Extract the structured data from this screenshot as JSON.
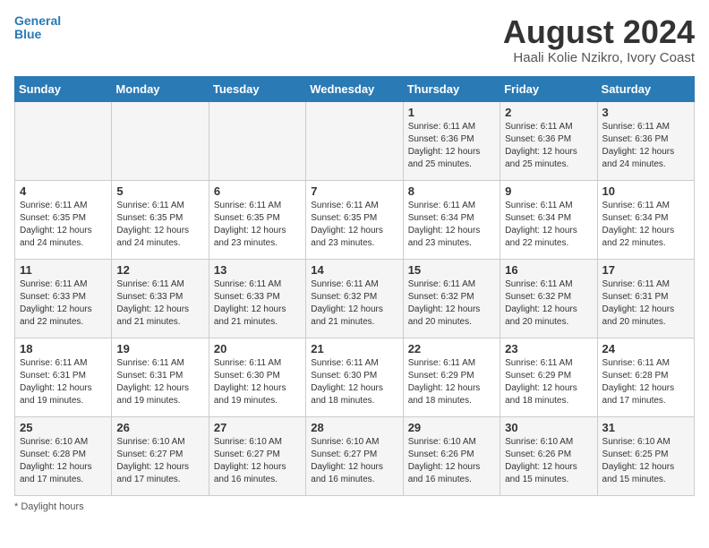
{
  "header": {
    "logo_line1": "General",
    "logo_line2": "Blue",
    "month": "August 2024",
    "location": "Haali Kolie Nzikro, Ivory Coast"
  },
  "footer": {
    "note": "Daylight hours"
  },
  "days_of_week": [
    "Sunday",
    "Monday",
    "Tuesday",
    "Wednesday",
    "Thursday",
    "Friday",
    "Saturday"
  ],
  "weeks": [
    [
      {
        "day": "",
        "text": ""
      },
      {
        "day": "",
        "text": ""
      },
      {
        "day": "",
        "text": ""
      },
      {
        "day": "",
        "text": ""
      },
      {
        "day": "1",
        "text": "Sunrise: 6:11 AM\nSunset: 6:36 PM\nDaylight: 12 hours\nand 25 minutes."
      },
      {
        "day": "2",
        "text": "Sunrise: 6:11 AM\nSunset: 6:36 PM\nDaylight: 12 hours\nand 25 minutes."
      },
      {
        "day": "3",
        "text": "Sunrise: 6:11 AM\nSunset: 6:36 PM\nDaylight: 12 hours\nand 24 minutes."
      }
    ],
    [
      {
        "day": "4",
        "text": "Sunrise: 6:11 AM\nSunset: 6:35 PM\nDaylight: 12 hours\nand 24 minutes."
      },
      {
        "day": "5",
        "text": "Sunrise: 6:11 AM\nSunset: 6:35 PM\nDaylight: 12 hours\nand 24 minutes."
      },
      {
        "day": "6",
        "text": "Sunrise: 6:11 AM\nSunset: 6:35 PM\nDaylight: 12 hours\nand 23 minutes."
      },
      {
        "day": "7",
        "text": "Sunrise: 6:11 AM\nSunset: 6:35 PM\nDaylight: 12 hours\nand 23 minutes."
      },
      {
        "day": "8",
        "text": "Sunrise: 6:11 AM\nSunset: 6:34 PM\nDaylight: 12 hours\nand 23 minutes."
      },
      {
        "day": "9",
        "text": "Sunrise: 6:11 AM\nSunset: 6:34 PM\nDaylight: 12 hours\nand 22 minutes."
      },
      {
        "day": "10",
        "text": "Sunrise: 6:11 AM\nSunset: 6:34 PM\nDaylight: 12 hours\nand 22 minutes."
      }
    ],
    [
      {
        "day": "11",
        "text": "Sunrise: 6:11 AM\nSunset: 6:33 PM\nDaylight: 12 hours\nand 22 minutes."
      },
      {
        "day": "12",
        "text": "Sunrise: 6:11 AM\nSunset: 6:33 PM\nDaylight: 12 hours\nand 21 minutes."
      },
      {
        "day": "13",
        "text": "Sunrise: 6:11 AM\nSunset: 6:33 PM\nDaylight: 12 hours\nand 21 minutes."
      },
      {
        "day": "14",
        "text": "Sunrise: 6:11 AM\nSunset: 6:32 PM\nDaylight: 12 hours\nand 21 minutes."
      },
      {
        "day": "15",
        "text": "Sunrise: 6:11 AM\nSunset: 6:32 PM\nDaylight: 12 hours\nand 20 minutes."
      },
      {
        "day": "16",
        "text": "Sunrise: 6:11 AM\nSunset: 6:32 PM\nDaylight: 12 hours\nand 20 minutes."
      },
      {
        "day": "17",
        "text": "Sunrise: 6:11 AM\nSunset: 6:31 PM\nDaylight: 12 hours\nand 20 minutes."
      }
    ],
    [
      {
        "day": "18",
        "text": "Sunrise: 6:11 AM\nSunset: 6:31 PM\nDaylight: 12 hours\nand 19 minutes."
      },
      {
        "day": "19",
        "text": "Sunrise: 6:11 AM\nSunset: 6:31 PM\nDaylight: 12 hours\nand 19 minutes."
      },
      {
        "day": "20",
        "text": "Sunrise: 6:11 AM\nSunset: 6:30 PM\nDaylight: 12 hours\nand 19 minutes."
      },
      {
        "day": "21",
        "text": "Sunrise: 6:11 AM\nSunset: 6:30 PM\nDaylight: 12 hours\nand 18 minutes."
      },
      {
        "day": "22",
        "text": "Sunrise: 6:11 AM\nSunset: 6:29 PM\nDaylight: 12 hours\nand 18 minutes."
      },
      {
        "day": "23",
        "text": "Sunrise: 6:11 AM\nSunset: 6:29 PM\nDaylight: 12 hours\nand 18 minutes."
      },
      {
        "day": "24",
        "text": "Sunrise: 6:11 AM\nSunset: 6:28 PM\nDaylight: 12 hours\nand 17 minutes."
      }
    ],
    [
      {
        "day": "25",
        "text": "Sunrise: 6:10 AM\nSunset: 6:28 PM\nDaylight: 12 hours\nand 17 minutes."
      },
      {
        "day": "26",
        "text": "Sunrise: 6:10 AM\nSunset: 6:27 PM\nDaylight: 12 hours\nand 17 minutes."
      },
      {
        "day": "27",
        "text": "Sunrise: 6:10 AM\nSunset: 6:27 PM\nDaylight: 12 hours\nand 16 minutes."
      },
      {
        "day": "28",
        "text": "Sunrise: 6:10 AM\nSunset: 6:27 PM\nDaylight: 12 hours\nand 16 minutes."
      },
      {
        "day": "29",
        "text": "Sunrise: 6:10 AM\nSunset: 6:26 PM\nDaylight: 12 hours\nand 16 minutes."
      },
      {
        "day": "30",
        "text": "Sunrise: 6:10 AM\nSunset: 6:26 PM\nDaylight: 12 hours\nand 15 minutes."
      },
      {
        "day": "31",
        "text": "Sunrise: 6:10 AM\nSunset: 6:25 PM\nDaylight: 12 hours\nand 15 minutes."
      }
    ]
  ]
}
